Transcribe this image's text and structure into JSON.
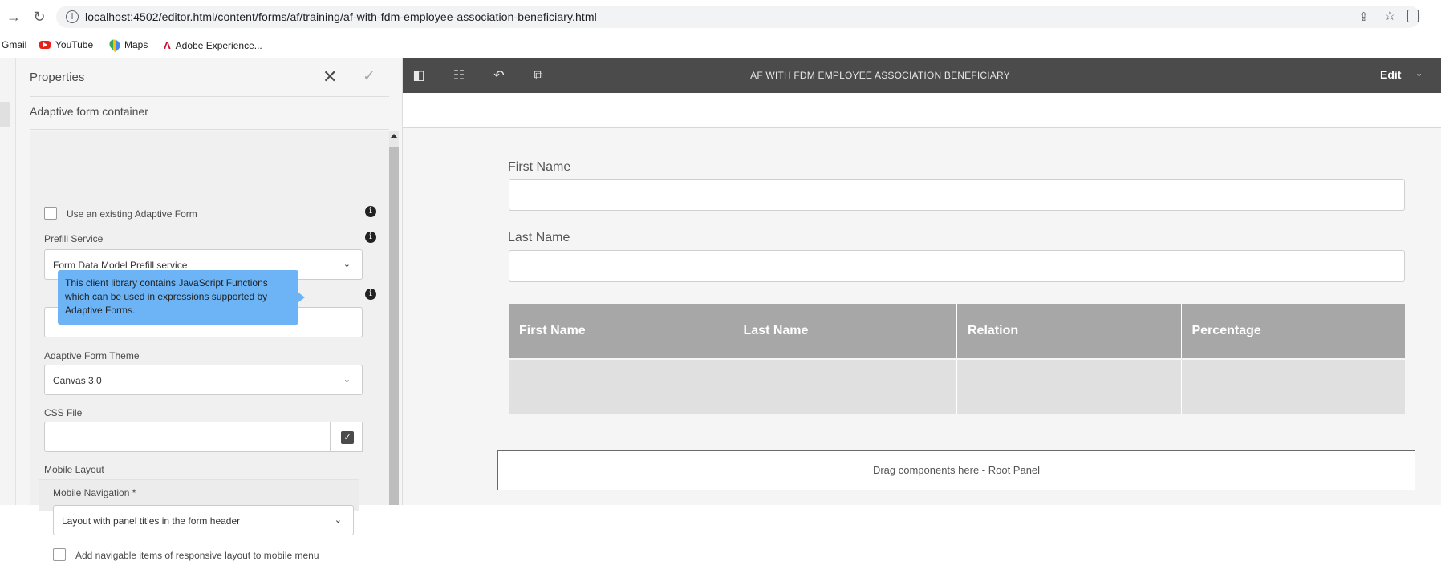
{
  "browser": {
    "url": "localhost:4502/editor.html/content/forms/af/training/af-with-fdm-employee-association-beneficiary.html",
    "bookmarks": [
      "Gmail",
      "YouTube",
      "Maps",
      "Adobe Experience..."
    ]
  },
  "properties_panel": {
    "title": "Properties",
    "subtitle": "Adaptive form container",
    "use_existing_label": "Use an existing Adaptive Form",
    "prefill_label": "Prefill Service",
    "prefill_value": "Form Data Model Prefill service",
    "tooltip": "This client library contains JavaScript Functions which can be used in expressions supported by Adaptive Forms.",
    "theme_label": "Adaptive Form Theme",
    "theme_value": "Canvas 3.0",
    "css_label": "CSS File",
    "css_value": "",
    "mobile_layout_label": "Mobile Layout",
    "mobile_nav_label": "Mobile Navigation *",
    "mobile_nav_value": "Layout with panel titles in the form header",
    "add_items_label": "Add navigable items of responsive layout to mobile menu"
  },
  "editor": {
    "title": "AF WITH FDM EMPLOYEE ASSOCIATION BENEFICIARY",
    "mode": "Edit",
    "first_name_label": "First Name",
    "last_name_label": "Last Name",
    "table_headers": [
      "First Name",
      "Last Name",
      "Relation",
      "Percentage"
    ],
    "drop_zone": "Drag components here - Root Panel"
  }
}
